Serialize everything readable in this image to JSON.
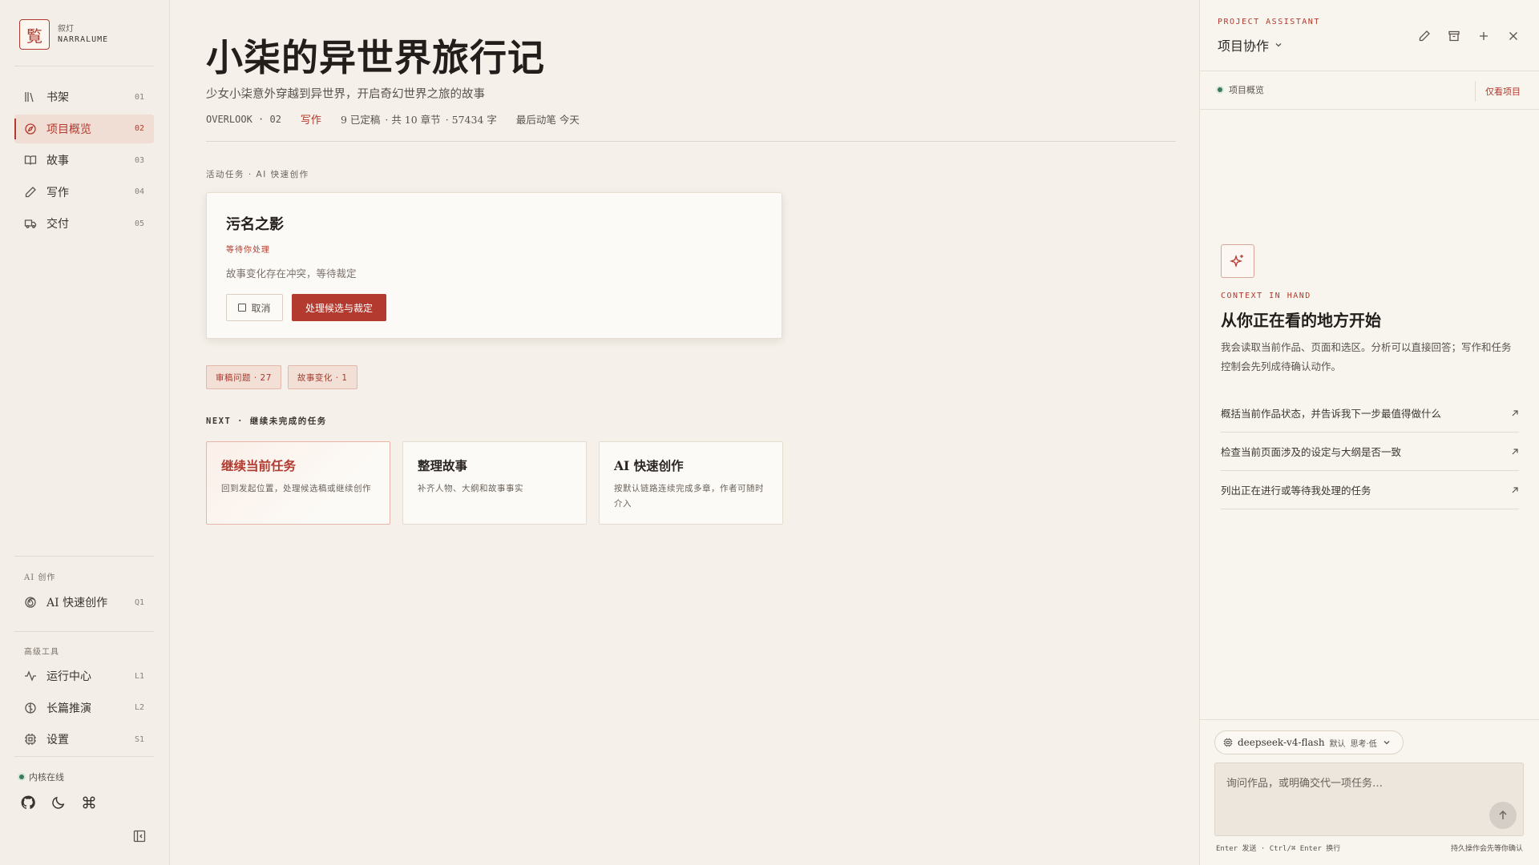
{
  "brand": {
    "logo_char": "覧",
    "name_cn": "叙灯",
    "name_en": "NARRALUME"
  },
  "sidebar": {
    "nav": [
      {
        "label": "书架",
        "code": "01",
        "icon": "bookshelf-icon"
      },
      {
        "label": "项目概览",
        "code": "02",
        "icon": "compass-icon",
        "active": true
      },
      {
        "label": "故事",
        "code": "03",
        "icon": "book-icon"
      },
      {
        "label": "写作",
        "code": "04",
        "icon": "pen-icon"
      },
      {
        "label": "交付",
        "code": "05",
        "icon": "truck-icon"
      }
    ],
    "ai_section_title": "AI 创作",
    "ai_nav": [
      {
        "label": "AI 快速创作",
        "code": "Q1",
        "icon": "spiral-icon"
      }
    ],
    "tools_section_title": "高级工具",
    "tools_nav": [
      {
        "label": "运行中心",
        "code": "L1",
        "icon": "activity-icon"
      },
      {
        "label": "长篇推演",
        "code": "L2",
        "icon": "brain-icon"
      },
      {
        "label": "设置",
        "code": "S1",
        "icon": "chip-icon"
      }
    ],
    "kernel_status": "内核在线",
    "footer_icons": [
      "github-icon",
      "moon-icon",
      "command-icon"
    ]
  },
  "project": {
    "title": "小柒的异世界旅行记",
    "subtitle": "少女小柒意外穿越到异世界，开启奇幻世界之旅的故事",
    "meta": {
      "overlook": "OVERLOOK · 02",
      "mode": "写作",
      "finalized": "9 已定稿",
      "chapters": "· 共 10 章节",
      "words": "· 57434 字",
      "last_edit": "最后动笔 今天"
    }
  },
  "active_task": {
    "section_label": "活动任务 · AI 快速创作",
    "title": "污名之影",
    "status": "等待你处理",
    "desc": "故事变化存在冲突，等待裁定",
    "cancel_label": "取消",
    "primary_label": "处理候选与裁定"
  },
  "badges": [
    {
      "label": "审稿问题 · 27"
    },
    {
      "label": "故事变化 · 1"
    }
  ],
  "next": {
    "section_label": "NEXT · 继续未完成的任务",
    "cards": [
      {
        "title": "继续当前任务",
        "desc": "回到发起位置，处理候选稿或继续创作",
        "highlight": true
      },
      {
        "title": "整理故事",
        "desc": "补齐人物、大纲和故事事实"
      },
      {
        "title": "AI 快速创作",
        "desc": "按默认链路连续完成多章，作者可随时介入"
      }
    ]
  },
  "assistant": {
    "kicker": "PROJECT ASSISTANT",
    "title": "项目协作",
    "tools": [
      "edit-icon",
      "archive-icon",
      "plus-icon",
      "close-icon"
    ],
    "scope": "项目概览",
    "scope_only": "仅看项目",
    "context_kicker": "CONTEXT IN HAND",
    "context_title": "从你正在看的地方开始",
    "context_desc": "我会读取当前作品、页面和选区。分析可以直接回答；写作和任务控制会先列成待确认动作。",
    "suggestions": [
      "概括当前作品状态，并告诉我下一步最值得做什么",
      "检查当前页面涉及的设定与大纲是否一致",
      "列出正在进行或等待我处理的任务"
    ],
    "model": {
      "name": "deepseek-v4-flash",
      "tag1": "默认",
      "tag2": "思考·低"
    },
    "input_placeholder": "询问作品，或明确交代一项任务…",
    "hint_left": "Enter 发送 · Ctrl/⌘ Enter 换行",
    "hint_right": "持久操作会先等你确认"
  }
}
